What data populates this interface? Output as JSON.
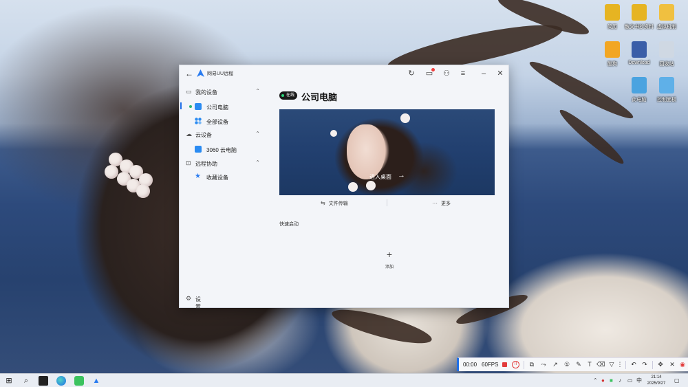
{
  "desktop": {
    "icons": [
      {
        "label": "简历",
        "icon": "folder-doc-icon",
        "color": "#e6b422"
      },
      {
        "label": "散文书抄资料",
        "icon": "folder-doc-icon",
        "color": "#e6b422"
      },
      {
        "label": "虚拟机制",
        "icon": "folder-icon",
        "color": "#f0c040"
      },
      {
        "label": "酷狗",
        "icon": "user-icon",
        "color": "#f2a623"
      },
      {
        "label": "Download",
        "icon": "download-folder-icon",
        "color": "#3a5ea8"
      },
      {
        "label": "回收站",
        "icon": "recycle-bin-icon",
        "color": "#cfd8e3"
      },
      {
        "label": "此电脑",
        "icon": "computer-icon",
        "color": "#4aa3e0"
      },
      {
        "label": "控制面板",
        "icon": "control-panel-icon",
        "color": "#5fb0e8"
      }
    ]
  },
  "window": {
    "title": "网易UU远程",
    "sidebar": {
      "sections": [
        {
          "label": "我的设备",
          "icon": "devices-icon"
        },
        {
          "label": "云设备",
          "icon": "cloud-icon"
        },
        {
          "label": "远程协助",
          "icon": "assist-icon"
        }
      ],
      "items": [
        {
          "label": "公司电脑",
          "active": true,
          "online": true,
          "color": "#1f6fe8"
        },
        {
          "label": "全部设备",
          "active": false,
          "color": "#1f6fe8"
        },
        {
          "label": "3060 云电脑",
          "active": false,
          "color": "#2a8bf2"
        },
        {
          "label": "收藏设备",
          "active": false,
          "color": "#1f6fe8"
        }
      ],
      "settings": "设置"
    },
    "main": {
      "status": "在线",
      "device_name": "公司电脑",
      "enter_desktop": "进入桌面",
      "actions": {
        "file_transfer": "文件传输",
        "more": "更多"
      },
      "quick_launch": "快速启动",
      "add": "添加"
    }
  },
  "recorder": {
    "time": "00:00",
    "fps": "60FPS"
  },
  "taskbar": {
    "tray_lang": "中",
    "time": "21:14",
    "date": "2025/9/27"
  },
  "colors": {
    "accent": "#1f6fe8",
    "online": "#2bb673",
    "record_red": "#e23b3b"
  }
}
